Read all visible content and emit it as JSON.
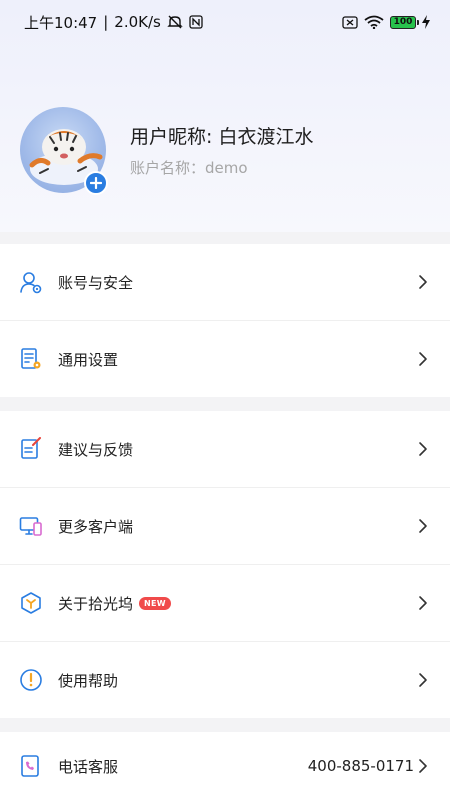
{
  "status_bar": {
    "time": "上午10:47",
    "network_speed": "2.0K/s",
    "battery_level": "100"
  },
  "profile": {
    "nickname": "用户昵称: 白衣渡江水",
    "account": "账户名称：demo"
  },
  "menu": {
    "account_security": "账号与安全",
    "general_settings": "通用设置",
    "feedback": "建议与反馈",
    "more_clients": "更多客户端",
    "about": "关于拾光坞",
    "about_badge": "NEW",
    "help": "使用帮助",
    "phone_service": "电话客服",
    "phone_number": "400-885-0171"
  },
  "colors": {
    "accent_blue": "#2a7de1",
    "accent_orange": "#f5a623",
    "badge_red": "#f04a4a"
  }
}
